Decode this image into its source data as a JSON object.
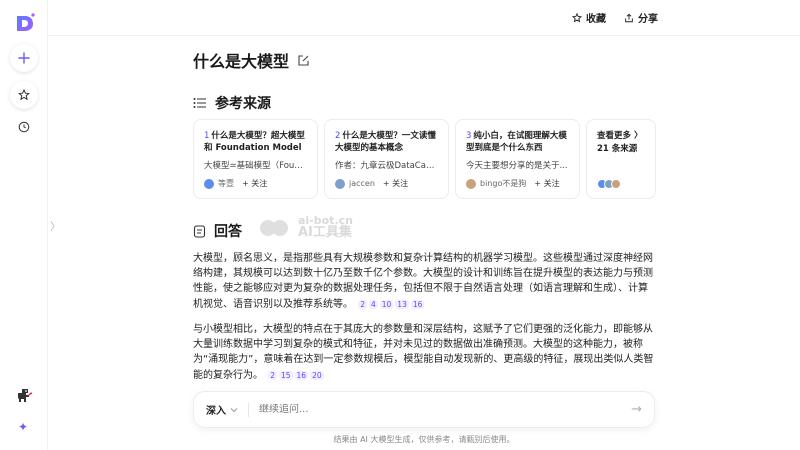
{
  "topbar": {
    "collect_label": "收藏",
    "share_label": "分享"
  },
  "question": {
    "title": "什么是大模型"
  },
  "sources": {
    "heading": "参考来源",
    "cards": [
      {
        "num": "1",
        "title": "什么是大模型？超大模型和 Foundation Model ...",
        "snippet": "大模型=基础模型（Foun...",
        "author": "等壹",
        "follow": "+ 关注",
        "avatar_color": "#5b8def"
      },
      {
        "num": "2",
        "title": "什么是大模型？一文读懂大模型的基本概念",
        "snippet": "作者：九章云极DataCan...",
        "author": "jaccen",
        "follow": "+ 关注",
        "avatar_color": "#7da0c8"
      },
      {
        "num": "3",
        "title": "纯小白，在试图理解大模型到底是个什么东西",
        "snippet": "今天主要想分享的是关于...",
        "author": "bingo不是狗",
        "follow": "+ 关注",
        "avatar_color": "#c9a27a"
      }
    ],
    "more": {
      "label": "查看更多 〉",
      "count": "21 条来源"
    }
  },
  "answer": {
    "heading": "回答",
    "watermark": [
      "ai-bot.cn",
      "AI工具集"
    ],
    "paragraphs": [
      {
        "text": "大模型，顾名思义，是指那些具有大规模参数和复杂计算结构的机器学习模型。这些模型通过深度神经网络构建，其规模可以达到数十亿乃至数千亿个参数。大模型的设计和训练旨在提升模型的表达能力与预测性能，使之能够应对更为复杂的数据处理任务，包括但不限于自然语言处理（如语言理解和生成）、计算机视觉、语音识别以及推荐系统等。",
        "citations": [
          "2",
          "4",
          "10",
          "13",
          "16"
        ]
      },
      {
        "text": "与小模型相比，大模型的特点在于其庞大的参数量和深层结构，这赋予了它们更强的泛化能力，即能够从大量训练数据中学习到复杂的模式和特征，并对未见过的数据做出准确预测。大模型的这种能力，被称为“涌现能力”，意味着在达到一定参数规模后，模型能自动发现新的、更高级的特征，展现出类似人类智能的复杂行为。",
        "citations": [
          "2",
          "15",
          "16",
          "20"
        ]
      }
    ]
  },
  "input": {
    "mode": "深入",
    "placeholder": "继续追问..."
  },
  "footer": {
    "note": "结果由 AI 大模型生成，仅供参考，请甄别后使用。"
  },
  "colors": {
    "accent": "#5a4cff",
    "logo": "#6a5cff"
  }
}
